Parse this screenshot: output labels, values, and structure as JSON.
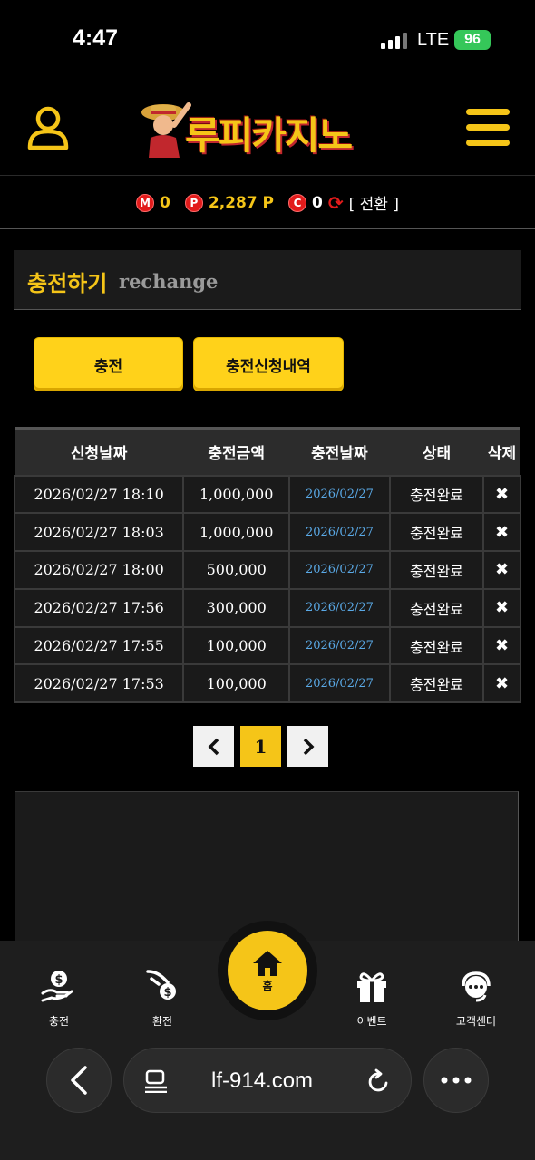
{
  "status_bar": {
    "time": "4:47",
    "network": "LTE",
    "battery": "96"
  },
  "header": {
    "logo_text": "루피카지노"
  },
  "balance": {
    "m_icon": "M",
    "m_value": "0",
    "p_icon": "P",
    "p_value": "2,287 P",
    "c_icon": "C",
    "c_value": "0",
    "convert_label": "[ 전환 ]"
  },
  "section": {
    "title_ko": "충전하기",
    "title_en": "rechange"
  },
  "buttons": {
    "charge": "충전",
    "history": "충전신청내역"
  },
  "table": {
    "headers": [
      "신청날짜",
      "충전금액",
      "충전날짜",
      "상태",
      "삭제"
    ],
    "rows": [
      {
        "request_date": "2026/02/27 18:10",
        "amount": "1,000,000",
        "charge_date": "2026/02/27",
        "status": "충전완료",
        "delete": "✖"
      },
      {
        "request_date": "2026/02/27 18:03",
        "amount": "1,000,000",
        "charge_date": "2026/02/27",
        "status": "충전완료",
        "delete": "✖"
      },
      {
        "request_date": "2026/02/27 18:00",
        "amount": "500,000",
        "charge_date": "2026/02/27",
        "status": "충전완료",
        "delete": "✖"
      },
      {
        "request_date": "2026/02/27 17:56",
        "amount": "300,000",
        "charge_date": "2026/02/27",
        "status": "충전완료",
        "delete": "✖"
      },
      {
        "request_date": "2026/02/27 17:55",
        "amount": "100,000",
        "charge_date": "2026/02/27",
        "status": "충전완료",
        "delete": "✖"
      },
      {
        "request_date": "2026/02/27 17:53",
        "amount": "100,000",
        "charge_date": "2026/02/27",
        "status": "충전완료",
        "delete": "✖"
      }
    ]
  },
  "pagination": {
    "prev": "‹",
    "current": "1",
    "next": "›"
  },
  "bottom_nav": {
    "deposit": "충전",
    "withdraw": "환전",
    "home": "홈",
    "event": "이벤트",
    "support": "고객센터"
  },
  "browser": {
    "url": "lf-914.com"
  },
  "colors": {
    "accent": "#f5c518",
    "coin": "#e21b1b",
    "link": "#5aa9e6"
  }
}
